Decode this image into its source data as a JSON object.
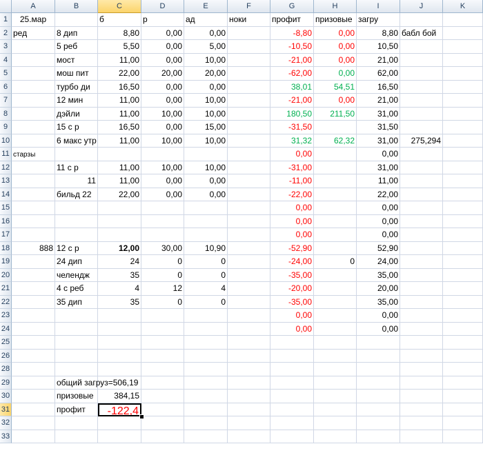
{
  "columns": [
    "A",
    "B",
    "C",
    "D",
    "E",
    "F",
    "G",
    "H",
    "I",
    "J",
    "K"
  ],
  "selected_column": "C",
  "selected_row": 31,
  "rows": [
    {
      "n": 1,
      "cells": {
        "A": {
          "v": "25.мар",
          "a": "c"
        },
        "B": {
          "v": "б",
          "a": "l",
          "col": "C"
        },
        "D": {
          "v": "р",
          "a": "l"
        },
        "E": {
          "v": "ад",
          "a": "l"
        },
        "F": {
          "v": "ноки",
          "a": "l"
        },
        "G": {
          "v": "профит",
          "a": "l"
        },
        "H": {
          "v": "призовые",
          "a": "l"
        },
        "I": {
          "v": "загру",
          "a": "l"
        },
        "J": {
          "v": ""
        }
      }
    },
    {
      "n": 2,
      "cells": {
        "A": {
          "v": "ред",
          "a": "l"
        },
        "B": {
          "v": "8 дип",
          "a": "l"
        },
        "C": {
          "v": "8,80"
        },
        "D": {
          "v": "0,00"
        },
        "E": {
          "v": "0,00"
        },
        "G": {
          "v": "-8,80",
          "c": "red"
        },
        "H": {
          "v": "0,00",
          "c": "red"
        },
        "I": {
          "v": "8,80"
        },
        "J": {
          "v": "бабл бой",
          "a": "l"
        }
      }
    },
    {
      "n": 3,
      "cells": {
        "B": {
          "v": "5 реб",
          "a": "l"
        },
        "C": {
          "v": "5,50"
        },
        "D": {
          "v": "0,00"
        },
        "E": {
          "v": "5,00"
        },
        "G": {
          "v": "-10,50",
          "c": "red"
        },
        "H": {
          "v": "0,00",
          "c": "red"
        },
        "I": {
          "v": "10,50"
        }
      }
    },
    {
      "n": 4,
      "cells": {
        "B": {
          "v": "мост",
          "a": "l"
        },
        "C": {
          "v": "11,00"
        },
        "D": {
          "v": "0,00"
        },
        "E": {
          "v": "10,00"
        },
        "G": {
          "v": "-21,00",
          "c": "red"
        },
        "H": {
          "v": "0,00",
          "c": "red"
        },
        "I": {
          "v": "21,00"
        }
      }
    },
    {
      "n": 5,
      "cells": {
        "B": {
          "v": "мош пит",
          "a": "l"
        },
        "C": {
          "v": "22,00"
        },
        "D": {
          "v": "20,00"
        },
        "E": {
          "v": "20,00"
        },
        "G": {
          "v": "-62,00",
          "c": "red"
        },
        "H": {
          "v": "0,00",
          "c": "green"
        },
        "I": {
          "v": "62,00"
        }
      }
    },
    {
      "n": 6,
      "cells": {
        "B": {
          "v": "турбо ди",
          "a": "l"
        },
        "C": {
          "v": "16,50"
        },
        "D": {
          "v": "0,00"
        },
        "E": {
          "v": "0,00"
        },
        "G": {
          "v": "38,01",
          "c": "green"
        },
        "H": {
          "v": "54,51",
          "c": "green"
        },
        "I": {
          "v": "16,50"
        }
      }
    },
    {
      "n": 7,
      "cells": {
        "B": {
          "v": "12 мин",
          "a": "l"
        },
        "C": {
          "v": "11,00"
        },
        "D": {
          "v": "0,00"
        },
        "E": {
          "v": "10,00"
        },
        "G": {
          "v": "-21,00",
          "c": "red"
        },
        "H": {
          "v": "0,00",
          "c": "red"
        },
        "I": {
          "v": "21,00"
        }
      }
    },
    {
      "n": 8,
      "cells": {
        "B": {
          "v": "дэйли",
          "a": "l"
        },
        "C": {
          "v": "11,00"
        },
        "D": {
          "v": "10,00"
        },
        "E": {
          "v": "10,00"
        },
        "G": {
          "v": "180,50",
          "c": "green"
        },
        "H": {
          "v": "211,50",
          "c": "green"
        },
        "I": {
          "v": "31,00"
        }
      }
    },
    {
      "n": 9,
      "cells": {
        "B": {
          "v": "15 с р",
          "a": "l"
        },
        "C": {
          "v": "16,50"
        },
        "D": {
          "v": "0,00"
        },
        "E": {
          "v": "15,00"
        },
        "G": {
          "v": "-31,50",
          "c": "red"
        },
        "I": {
          "v": "31,50"
        }
      }
    },
    {
      "n": 10,
      "cells": {
        "B": {
          "v": "6 макс утр",
          "a": "l"
        },
        "C": {
          "v": "11,00"
        },
        "D": {
          "v": "10,00"
        },
        "E": {
          "v": "10,00"
        },
        "G": {
          "v": "31,32",
          "c": "green"
        },
        "H": {
          "v": "62,32",
          "c": "green"
        },
        "I": {
          "v": "31,00"
        },
        "J": {
          "v": "275,294"
        }
      }
    },
    {
      "n": 11,
      "cells": {
        "A": {
          "v": "старзы",
          "a": "l",
          "small": true
        },
        "G": {
          "v": "0,00",
          "c": "red"
        },
        "I": {
          "v": "0,00"
        }
      }
    },
    {
      "n": 12,
      "cells": {
        "B": {
          "v": "11 с р",
          "a": "l"
        },
        "C": {
          "v": "11,00"
        },
        "D": {
          "v": "10,00"
        },
        "E": {
          "v": "10,00"
        },
        "G": {
          "v": "-31,00",
          "c": "red"
        },
        "I": {
          "v": "31,00"
        }
      }
    },
    {
      "n": 13,
      "cells": {
        "B": {
          "v": "11"
        },
        "C": {
          "v": "11,00"
        },
        "D": {
          "v": "0,00"
        },
        "E": {
          "v": "0,00"
        },
        "G": {
          "v": "-11,00",
          "c": "red"
        },
        "I": {
          "v": "11,00"
        }
      }
    },
    {
      "n": 14,
      "cells": {
        "B": {
          "v": "бильд 22",
          "a": "l"
        },
        "C": {
          "v": "22,00"
        },
        "D": {
          "v": "0,00"
        },
        "E": {
          "v": "0,00"
        },
        "G": {
          "v": "-22,00",
          "c": "red"
        },
        "I": {
          "v": "22,00"
        }
      }
    },
    {
      "n": 15,
      "cells": {
        "G": {
          "v": "0,00",
          "c": "red"
        },
        "I": {
          "v": "0,00"
        }
      }
    },
    {
      "n": 16,
      "cells": {
        "G": {
          "v": "0,00",
          "c": "red"
        },
        "I": {
          "v": "0,00"
        }
      }
    },
    {
      "n": 17,
      "cells": {
        "G": {
          "v": "0,00",
          "c": "red"
        },
        "I": {
          "v": "0,00"
        }
      }
    },
    {
      "n": 18,
      "cells": {
        "A": {
          "v": "888"
        },
        "B": {
          "v": "12 с р",
          "a": "l"
        },
        "C": {
          "v": "12,00",
          "b": true
        },
        "D": {
          "v": "30,00"
        },
        "E": {
          "v": "10,90"
        },
        "G": {
          "v": "-52,90",
          "c": "red"
        },
        "I": {
          "v": "52,90"
        }
      }
    },
    {
      "n": 19,
      "cells": {
        "B": {
          "v": "24 дип",
          "a": "l"
        },
        "C": {
          "v": "24"
        },
        "D": {
          "v": "0"
        },
        "E": {
          "v": "0"
        },
        "G": {
          "v": "-24,00",
          "c": "red"
        },
        "H": {
          "v": "0"
        },
        "I": {
          "v": "24,00"
        }
      }
    },
    {
      "n": 20,
      "cells": {
        "B": {
          "v": "челендж",
          "a": "l"
        },
        "C": {
          "v": "35"
        },
        "D": {
          "v": "0"
        },
        "E": {
          "v": "0"
        },
        "G": {
          "v": "-35,00",
          "c": "red"
        },
        "I": {
          "v": "35,00"
        }
      }
    },
    {
      "n": 21,
      "cells": {
        "B": {
          "v": "4 с реб",
          "a": "l"
        },
        "C": {
          "v": "4"
        },
        "D": {
          "v": "12"
        },
        "E": {
          "v": "4"
        },
        "G": {
          "v": "-20,00",
          "c": "red"
        },
        "I": {
          "v": "20,00"
        }
      }
    },
    {
      "n": 22,
      "cells": {
        "B": {
          "v": "35 дип",
          "a": "l"
        },
        "C": {
          "v": "35"
        },
        "D": {
          "v": "0"
        },
        "E": {
          "v": "0"
        },
        "G": {
          "v": "-35,00",
          "c": "red"
        },
        "I": {
          "v": "35,00"
        }
      }
    },
    {
      "n": 23,
      "cells": {
        "G": {
          "v": "0,00",
          "c": "red"
        },
        "I": {
          "v": "0,00"
        }
      }
    },
    {
      "n": 24,
      "cells": {
        "G": {
          "v": "0,00",
          "c": "red"
        },
        "I": {
          "v": "0,00"
        }
      }
    },
    {
      "n": 25,
      "cells": {}
    },
    {
      "n": 26,
      "cells": {}
    },
    {
      "n": 28,
      "cells": {}
    },
    {
      "n": 29,
      "cells": {
        "B": {
          "v": "общий загруз=506,19",
          "a": "l"
        }
      }
    },
    {
      "n": 30,
      "cells": {
        "B": {
          "v": "призовые",
          "a": "l"
        },
        "C": {
          "v": "384,15"
        }
      }
    },
    {
      "n": 31,
      "cells": {
        "B": {
          "v": "профит",
          "a": "l"
        },
        "C": {
          "v": "-122,4",
          "c": "red",
          "big": true,
          "active": true
        }
      }
    },
    {
      "n": 32,
      "cells": {}
    },
    {
      "n": 33,
      "cells": {}
    }
  ]
}
